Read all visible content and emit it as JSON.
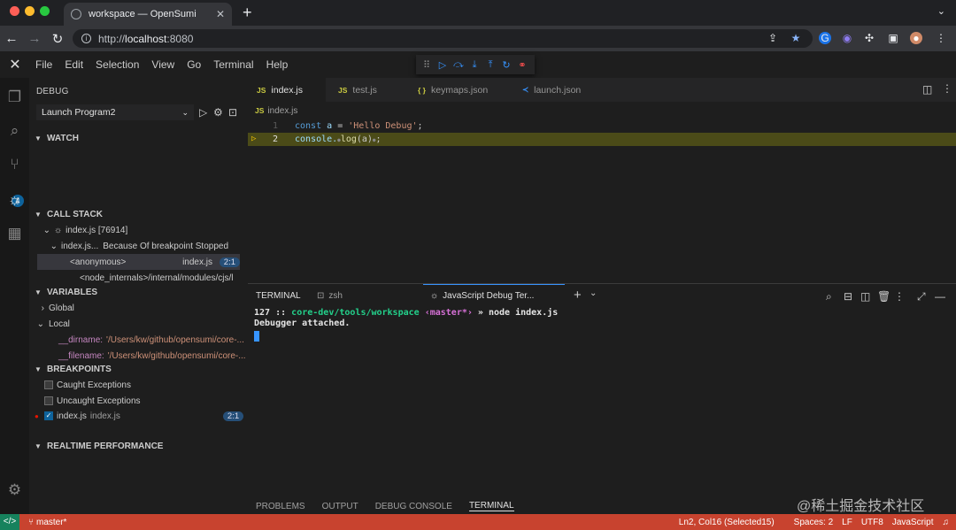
{
  "browser": {
    "tab_title": "workspace — OpenSumi",
    "url_scheme": "http://",
    "url_host": "localhost",
    "url_port": ":8080"
  },
  "menu": [
    "File",
    "Edit",
    "Selection",
    "View",
    "Go",
    "Terminal",
    "Help"
  ],
  "activity": {
    "scm_badge": "4"
  },
  "sidebar": {
    "title": "DEBUG",
    "config_select": "Launch Program2",
    "watch_header": "WATCH",
    "callstack_header": "CALL STACK",
    "callstack": {
      "process": "index.js [76914]",
      "thread": "index.js...",
      "thread_reason": "Because Of breakpoint Stopped",
      "frames": [
        {
          "name": "<anonymous>",
          "file": "index.js",
          "pos": "2:1"
        },
        {
          "name": "<node_internals>/internal/modules/cjs/l",
          "file": "",
          "pos": ""
        }
      ]
    },
    "variables_header": "VARIABLES",
    "variables": {
      "global": "Global",
      "local": "Local",
      "items": [
        {
          "name": "__dirname:",
          "value": "'/Users/kw/github/opensumi/core-..."
        },
        {
          "name": "__filename:",
          "value": "'/Users/kw/github/opensumi/core-..."
        }
      ]
    },
    "breakpoints_header": "BREAKPOINTS",
    "breakpoints": {
      "caught": "Caught Exceptions",
      "uncaught": "Uncaught Exceptions",
      "file": "index.js",
      "file_path": "index.js",
      "file_pos": "2:1"
    },
    "perf_header": "REALTIME PERFORMANCE"
  },
  "editor": {
    "tabs": [
      {
        "icon": "JS",
        "label": "index.js"
      },
      {
        "icon": "JS",
        "label": "test.js"
      },
      {
        "icon": "{ }",
        "label": "keymaps.json"
      },
      {
        "icon": "≺",
        "label": "launch.json"
      }
    ],
    "breadcrumb_icon": "JS",
    "breadcrumb": "index.js",
    "lines": [
      {
        "num": "1",
        "kw": "const",
        "var": "a",
        "op": " = ",
        "str": "'Hello Debug'",
        "end": ";"
      },
      {
        "num": "2",
        "obj": "console.",
        "fn": "log",
        "args": "(a)",
        "end": ";"
      }
    ]
  },
  "terminal": {
    "header": "TERMINAL",
    "tabs": [
      "zsh",
      "JavaScript Debug Ter..."
    ],
    "prompt_num": "127",
    "prompt_sep": "::",
    "prompt_path": "core-dev/tools/workspace",
    "prompt_branch": "‹master*›",
    "prompt_arrow": "»",
    "command": "node index.js",
    "output": "Debugger attached."
  },
  "panel_tabs": [
    "PROBLEMS",
    "OUTPUT",
    "DEBUG CONSOLE",
    "TERMINAL"
  ],
  "statusbar": {
    "branch": "master*",
    "position": "Ln2, Col16 (Selected15)",
    "spaces": "Spaces: 2",
    "eol": "LF",
    "encoding": "UTF8",
    "language": "JavaScript"
  },
  "watermark": "@稀土掘金技术社区"
}
